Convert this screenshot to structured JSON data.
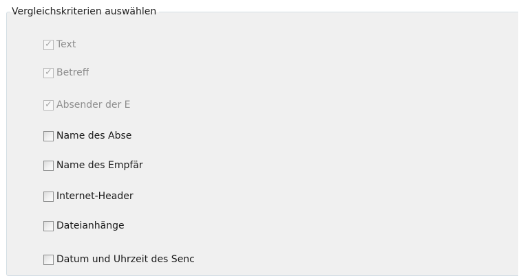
{
  "group": {
    "title": "Vergleichskriterien auswählen"
  },
  "options": [
    {
      "label": "Text",
      "checked": true,
      "enabled": false
    },
    {
      "label": "Betreff",
      "checked": true,
      "enabled": false
    },
    {
      "label": "Absender der E",
      "checked": true,
      "enabled": false
    },
    {
      "label": "Name des Abse",
      "checked": false,
      "enabled": true
    },
    {
      "label": "Name des Empfär",
      "checked": false,
      "enabled": true
    },
    {
      "label": "Internet-Header",
      "checked": false,
      "enabled": true
    },
    {
      "label": "Dateianhänge",
      "checked": false,
      "enabled": true
    },
    {
      "label": "Datum und Uhrzeit des Senc",
      "checked": false,
      "enabled": true
    }
  ]
}
